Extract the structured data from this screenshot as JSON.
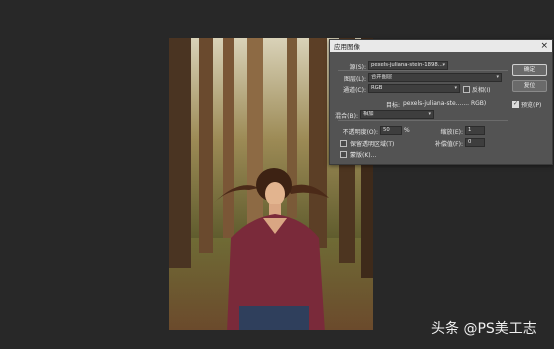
{
  "dialog": {
    "title": "应用图像",
    "source_label": "源(S):",
    "source_value": "pexels-juliana-stein-1898...",
    "layer_label": "图层(L):",
    "layer_value": "合并图层",
    "channel_label": "通道(C):",
    "channel_value": "RGB",
    "invert_label": "反相(I)",
    "target_label": "目标:",
    "target_value": "pexels-juliana-ste....... RGB)",
    "blending_label": "混合(B):",
    "blending_value": "相加",
    "opacity_label": "不透明度(O):",
    "opacity_value": "50",
    "opacity_unit": "%",
    "scale_label": "缩放(E):",
    "scale_value": "1",
    "preserve_label": "保留透明区域(T)",
    "offset_label": "补偿值(F):",
    "offset_value": "0",
    "mask_label": "蒙版(K)...",
    "ok_label": "确定",
    "reset_label": "复位",
    "preview_label": "预览(P)",
    "preview_checked": true,
    "close_glyph": "×"
  },
  "watermark": "头条 @PS美工志",
  "colors": {
    "dialog_bg": "#535353",
    "workspace_bg": "#282828",
    "titlebar_bg": "#e9e9e9"
  }
}
